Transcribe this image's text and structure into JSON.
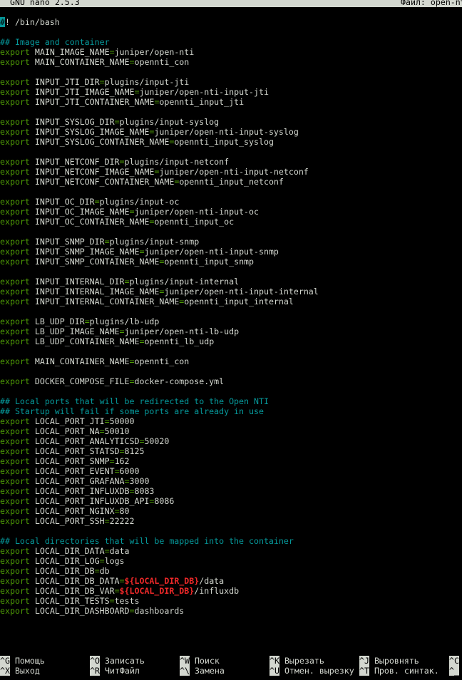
{
  "app": {
    "title": "GNU nano 2.5.3",
    "file_label": "Файл: open-nt"
  },
  "colors": {
    "keyword": "#4e9a06",
    "comment": "#06989a",
    "expansion": "#ef2929",
    "text": "#d3d7cf",
    "background": "#000000"
  },
  "editor": {
    "cursor_char": "#",
    "lines": [
      {
        "t": "shebang",
        "text": "! /bin/bash"
      },
      {
        "t": "blank"
      },
      {
        "t": "comment",
        "text": "## Image and container"
      },
      {
        "t": "export",
        "name": "MAIN_IMAGE_NAME",
        "value": "juniper/open-nti"
      },
      {
        "t": "export",
        "name": "MAIN_CONTAINER_NAME",
        "value": "opennti_con"
      },
      {
        "t": "blank"
      },
      {
        "t": "export",
        "name": "INPUT_JTI_DIR",
        "value": "plugins/input-jti"
      },
      {
        "t": "export",
        "name": "INPUT_JTI_IMAGE_NAME",
        "value": "juniper/open-nti-input-jti"
      },
      {
        "t": "export",
        "name": "INPUT_JTI_CONTAINER_NAME",
        "value": "opennti_input_jti"
      },
      {
        "t": "blank"
      },
      {
        "t": "export",
        "name": "INPUT_SYSLOG_DIR",
        "value": "plugins/input-syslog"
      },
      {
        "t": "export",
        "name": "INPUT_SYSLOG_IMAGE_NAME",
        "value": "juniper/open-nti-input-syslog"
      },
      {
        "t": "export",
        "name": "INPUT_SYSLOG_CONTAINER_NAME",
        "value": "opennti_input_syslog"
      },
      {
        "t": "blank"
      },
      {
        "t": "export",
        "name": "INPUT_NETCONF_DIR",
        "value": "plugins/input-netconf"
      },
      {
        "t": "export",
        "name": "INPUT_NETCONF_IMAGE_NAME",
        "value": "juniper/open-nti-input-netconf"
      },
      {
        "t": "export",
        "name": "INPUT_NETCONF_CONTAINER_NAME",
        "value": "opennti_input_netconf"
      },
      {
        "t": "blank"
      },
      {
        "t": "export",
        "name": "INPUT_OC_DIR",
        "value": "plugins/input-oc"
      },
      {
        "t": "export",
        "name": "INPUT_OC_IMAGE_NAME",
        "value": "juniper/open-nti-input-oc"
      },
      {
        "t": "export",
        "name": "INPUT_OC_CONTAINER_NAME",
        "value": "opennti_input_oc"
      },
      {
        "t": "blank"
      },
      {
        "t": "export",
        "name": "INPUT_SNMP_DIR",
        "value": "plugins/input-snmp"
      },
      {
        "t": "export",
        "name": "INPUT_SNMP_IMAGE_NAME",
        "value": "juniper/open-nti-input-snmp"
      },
      {
        "t": "export",
        "name": "INPUT_SNMP_CONTAINER_NAME",
        "value": "opennti_input_snmp"
      },
      {
        "t": "blank"
      },
      {
        "t": "export",
        "name": "INPUT_INTERNAL_DIR",
        "value": "plugins/input-internal"
      },
      {
        "t": "export",
        "name": "INPUT_INTERNAL_IMAGE_NAME",
        "value": "juniper/open-nti-input-internal"
      },
      {
        "t": "export",
        "name": "INPUT_INTERNAL_CONTAINER_NAME",
        "value": "opennti_input_internal"
      },
      {
        "t": "blank"
      },
      {
        "t": "export",
        "name": "LB_UDP_DIR",
        "value": "plugins/lb-udp"
      },
      {
        "t": "export",
        "name": "LB_UDP_IMAGE_NAME",
        "value": "juniper/open-nti-lb-udp"
      },
      {
        "t": "export",
        "name": "LB_UDP_CONTAINER_NAME",
        "value": "opennti_lb_udp"
      },
      {
        "t": "blank"
      },
      {
        "t": "export",
        "name": "MAIN_CONTAINER_NAME",
        "value": "opennti_con"
      },
      {
        "t": "blank"
      },
      {
        "t": "export",
        "name": "DOCKER_COMPOSE_FILE",
        "value": "docker-compose.yml"
      },
      {
        "t": "blank"
      },
      {
        "t": "comment",
        "text": "## Local ports that will be redirected to the Open NTI"
      },
      {
        "t": "comment",
        "text": "## Startup will fail if some ports are already in use"
      },
      {
        "t": "export",
        "name": "LOCAL_PORT_JTI",
        "value": "50000"
      },
      {
        "t": "export",
        "name": "LOCAL_PORT_NA",
        "value": "50010"
      },
      {
        "t": "export",
        "name": "LOCAL_PORT_ANALYTICSD",
        "value": "50020"
      },
      {
        "t": "export",
        "name": "LOCAL_PORT_STATSD",
        "value": "8125"
      },
      {
        "t": "export",
        "name": "LOCAL_PORT_SNMP",
        "value": "162"
      },
      {
        "t": "export",
        "name": "LOCAL_PORT_EVENT",
        "value": "6000"
      },
      {
        "t": "export",
        "name": "LOCAL_PORT_GRAFANA",
        "value": "3000"
      },
      {
        "t": "export",
        "name": "LOCAL_PORT_INFLUXDB",
        "value": "8083"
      },
      {
        "t": "export",
        "name": "LOCAL_PORT_INFLUXDB_API",
        "value": "8086"
      },
      {
        "t": "export",
        "name": "LOCAL_PORT_NGINX",
        "value": "80"
      },
      {
        "t": "export",
        "name": "LOCAL_PORT_SSH",
        "value": "22222"
      },
      {
        "t": "blank"
      },
      {
        "t": "comment",
        "text": "## Local directories that will be mapped into the container"
      },
      {
        "t": "export",
        "name": "LOCAL_DIR_DATA",
        "value": "data"
      },
      {
        "t": "export",
        "name": "LOCAL_DIR_LOG",
        "value": "logs"
      },
      {
        "t": "export",
        "name": "LOCAL_DIR_DB",
        "value": "db"
      },
      {
        "t": "export",
        "name": "LOCAL_DIR_DB_DATA",
        "expansion": "${LOCAL_DIR_DB}",
        "value": "/data"
      },
      {
        "t": "export",
        "name": "LOCAL_DIR_DB_VAR",
        "expansion": "${LOCAL_DIR_DB}",
        "value": "/influxdb"
      },
      {
        "t": "export",
        "name": "LOCAL_DIR_TESTS",
        "value": "tests"
      },
      {
        "t": "export",
        "name": "LOCAL_DIR_DASHBOARD",
        "value": "dashboards"
      }
    ]
  },
  "shortcuts": {
    "row1": [
      {
        "key": "^G",
        "label": "Помощь"
      },
      {
        "key": "^O",
        "label": "Записать"
      },
      {
        "key": "^W",
        "label": "Поиск"
      },
      {
        "key": "^K",
        "label": "Вырезать"
      },
      {
        "key": "^J",
        "label": "Выровнять"
      },
      {
        "key": "^C",
        "label": ""
      }
    ],
    "row2": [
      {
        "key": "^X",
        "label": "Выход"
      },
      {
        "key": "^R",
        "label": "ЧитФайл"
      },
      {
        "key": "^\\",
        "label": "Замена"
      },
      {
        "key": "^U",
        "label": "Отмен. вырезку"
      },
      {
        "key": "^T",
        "label": "Пров. синтак."
      },
      {
        "key": "^_",
        "label": ""
      }
    ]
  }
}
